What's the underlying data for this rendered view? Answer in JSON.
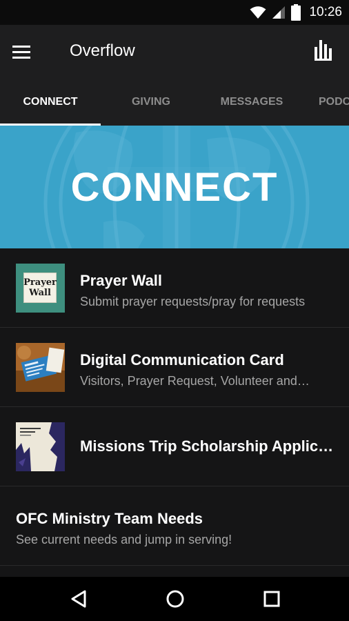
{
  "status_bar": {
    "time": "10:26",
    "icons": [
      "wifi-icon",
      "signal-icon",
      "battery-icon"
    ]
  },
  "app_bar": {
    "title": "Overflow",
    "menu_icon": "hamburger-menu-icon",
    "action_icon": "bar-chart-icon"
  },
  "tabs": [
    {
      "label": "CONNECT",
      "active": true
    },
    {
      "label": "GIVING",
      "active": false
    },
    {
      "label": "MESSAGES",
      "active": false
    },
    {
      "label": "PODC",
      "active": false
    }
  ],
  "hero": {
    "title": "CONNECT",
    "background_color": "#3aa3c9"
  },
  "items": [
    {
      "title": "Prayer Wall",
      "subtitle": "Submit prayer requests/pray for requests",
      "thumb_lines": [
        "Prayer",
        "Wall"
      ]
    },
    {
      "title": "Digital Communication Card",
      "subtitle": "Visitors, Prayer Request, Volunteer and…"
    },
    {
      "title": "Missions Trip Scholarship Applic…",
      "subtitle": ""
    },
    {
      "title": "OFC Ministry Team Needs",
      "subtitle": "See current needs and jump in serving!"
    }
  ],
  "nav_bar": {
    "icons": [
      "back-icon",
      "home-icon",
      "recent-apps-icon"
    ]
  },
  "colors": {
    "accent": "#3aa3c9",
    "app_bar": "#1e1e1f",
    "background": "#151516",
    "tab_inactive": "#8d8d8d"
  }
}
